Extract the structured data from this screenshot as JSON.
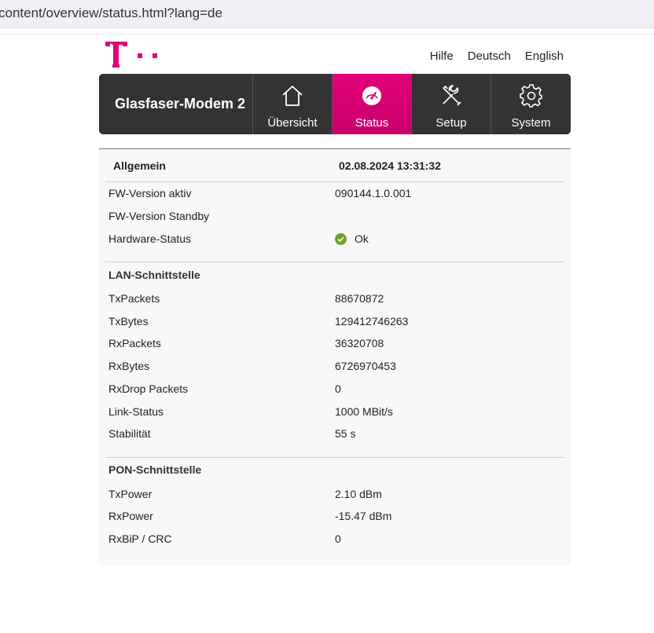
{
  "browser": {
    "url": "content/overview/status.html?lang=de"
  },
  "header": {
    "links": [
      "Hilfe",
      "Deutsch",
      "English"
    ]
  },
  "nav": {
    "brand": "Glasfaser-Modem 2",
    "tabs": [
      {
        "label": "Übersicht",
        "icon": "home-icon"
      },
      {
        "label": "Status",
        "icon": "gauge-icon",
        "active": true
      },
      {
        "label": "Setup",
        "icon": "tools-icon"
      },
      {
        "label": "System",
        "icon": "gear-icon"
      }
    ],
    "active_color": "#e2007a"
  },
  "general": {
    "title": "Allgemein",
    "datetime": "02.08.2024 13:31:32",
    "rows": [
      {
        "label": "FW-Version aktiv",
        "value": "090144.1.0.001"
      },
      {
        "label": "FW-Version Standby",
        "value": ""
      },
      {
        "label": "Hardware-Status",
        "value": "Ok",
        "icon": "check-icon"
      }
    ]
  },
  "lan": {
    "title": "LAN-Schnittstelle",
    "rows": [
      {
        "label": "TxPackets",
        "value": "88670872"
      },
      {
        "label": "TxBytes",
        "value": "129412746263"
      },
      {
        "label": "RxPackets",
        "value": "36320708"
      },
      {
        "label": "RxBytes",
        "value": "6726970453"
      },
      {
        "label": "RxDrop Packets",
        "value": "0"
      },
      {
        "label": "Link-Status",
        "value": "1000 MBit/s"
      },
      {
        "label": "Stabilität",
        "value": "55 s"
      }
    ]
  },
  "pon": {
    "title": "PON-Schnittstelle",
    "rows": [
      {
        "label": "TxPower",
        "value": "2.10 dBm"
      },
      {
        "label": "RxPower",
        "value": "-15.47 dBm"
      },
      {
        "label": "RxBiP / CRC",
        "value": "0"
      }
    ]
  }
}
